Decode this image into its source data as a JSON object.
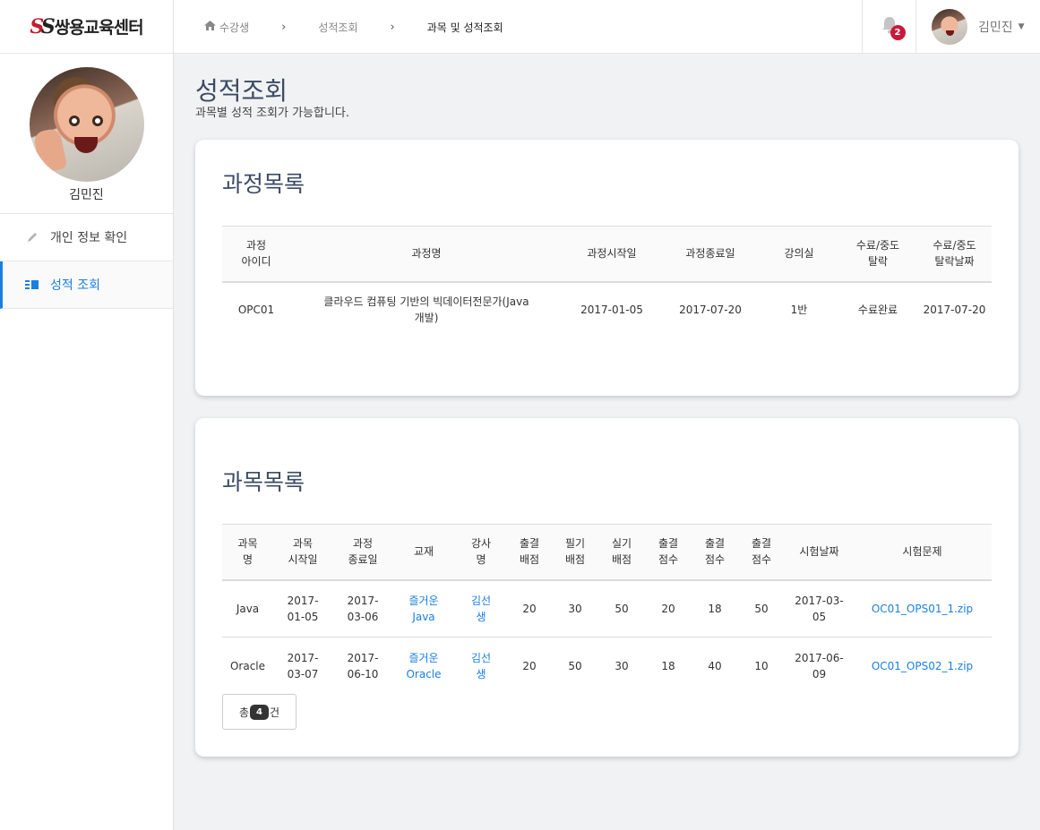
{
  "logo": {
    "mark_s1": "S",
    "mark_s2": "S",
    "text": "쌍용교육센터"
  },
  "profile": {
    "name": "김민진"
  },
  "sidebar": {
    "items": [
      {
        "label": "개인 정보 확인",
        "icon": "pencil-icon",
        "active": false
      },
      {
        "label": "성적 조회",
        "icon": "list-icon",
        "active": true
      }
    ]
  },
  "breadcrumb": {
    "home": "수강생",
    "sep": "›",
    "second": "성적조회",
    "current": "과목 및 성적조회"
  },
  "topbar": {
    "notification_count": "2",
    "user_name": "김민진",
    "caret": "▼"
  },
  "page": {
    "title": "성적조회",
    "subtitle": "과목별 성적 조회가 가능합니다."
  },
  "course_card": {
    "title": "과정목록",
    "headers": [
      "과정\n아이디",
      "과정명",
      "과정시작일",
      "과정종료일",
      "강의실",
      "수료/중도\n탈락",
      "수료/중도\n탈락날짜"
    ],
    "rows": [
      [
        "OPC01",
        "클라우드 컴퓨팅 기반의 빅데이터전문가(Java\n개발)",
        "2017-01-05",
        "2017-07-20",
        "1반",
        "수료완료",
        "2017-07-20"
      ]
    ]
  },
  "subject_card": {
    "title": "과목목록",
    "headers": [
      "과목\n명",
      "과목\n시작일",
      "과정\n종료일",
      "교재",
      "강사\n명",
      "출결\n배점",
      "필기\n배점",
      "실기\n배점",
      "출결\n점수",
      "출결\n점수",
      "출결\n점수",
      "시험날짜",
      "시험문제"
    ],
    "rows": [
      [
        "Java",
        "2017-\n01-05",
        "2017-\n03-06",
        "즐거운\nJava",
        "김선\n생",
        "20",
        "30",
        "50",
        "20",
        "18",
        "50",
        "2017-03-\n05",
        "OC01_OPS01_1.zip"
      ],
      [
        "Oracle",
        "2017-\n03-07",
        "2017-\n06-10",
        "즐거운\nOracle",
        "김선\n생",
        "20",
        "50",
        "30",
        "18",
        "40",
        "10",
        "2017-06-\n09",
        "OC01_OPS02_1.zip"
      ]
    ],
    "total": {
      "prefix": "총",
      "count": "4",
      "suffix": "건"
    }
  }
}
